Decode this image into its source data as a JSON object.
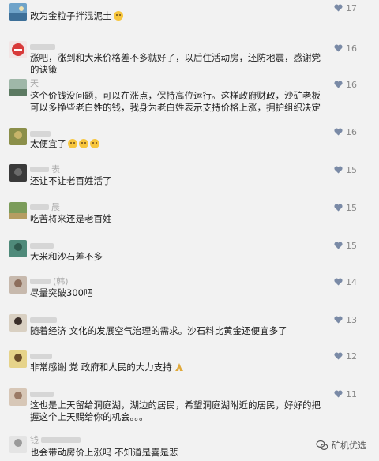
{
  "comments": [
    {
      "text": "改为金粒子拌混泥土",
      "likes": "17",
      "name": ""
    },
    {
      "text": "涨吧，涨到和大米价格差不多就好了，以后住活动房，还防地震，感谢党的诀策",
      "likes": "16",
      "name": ""
    },
    {
      "text": "这个价钱没问题，可以在涨点，保持高位运行。这样政府财政，沙矿老板可以多挣些老白姓的钱，我身为老白姓表示支持价格上涨，拥护组织决定",
      "likes": "16",
      "name": "天"
    },
    {
      "text": "太便宜了",
      "likes": "16",
      "name": ""
    },
    {
      "text": "还让不让老百姓活了",
      "likes": "15",
      "name": "表"
    },
    {
      "text": "吃苦将来还是老百姓",
      "likes": "15",
      "name": "晨"
    },
    {
      "text": "大米和沙石差不多",
      "likes": "15",
      "name": ""
    },
    {
      "text": "尽量突破300吧",
      "likes": "14",
      "name": "(韩)"
    },
    {
      "text": "随着经济  文化的发展空气治理的需求。沙石料比黄金还便宜多了",
      "likes": "13",
      "name": ""
    },
    {
      "text": "非常感谢 党  政府和人民的大力支持",
      "likes": "12",
      "name": ""
    },
    {
      "text": "这也是上天留给洞庭湖，湖边的居民，希望洞庭湖附近的居民，好好的把握这个上天赐给你的机会。。。",
      "likes": "11",
      "name": ""
    },
    {
      "text": "也会带动房价上涨吗  不知道是喜是悲",
      "likes": "",
      "name": "钱"
    }
  ],
  "watermark": {
    "text": "矿机优选"
  },
  "icons": {
    "like": "heart-icon",
    "watermark": "wechat-icon"
  },
  "colors": {
    "background": "#f2f2f2",
    "text": "#222222",
    "muted": "#888888",
    "heart": "#7a8aa6"
  }
}
